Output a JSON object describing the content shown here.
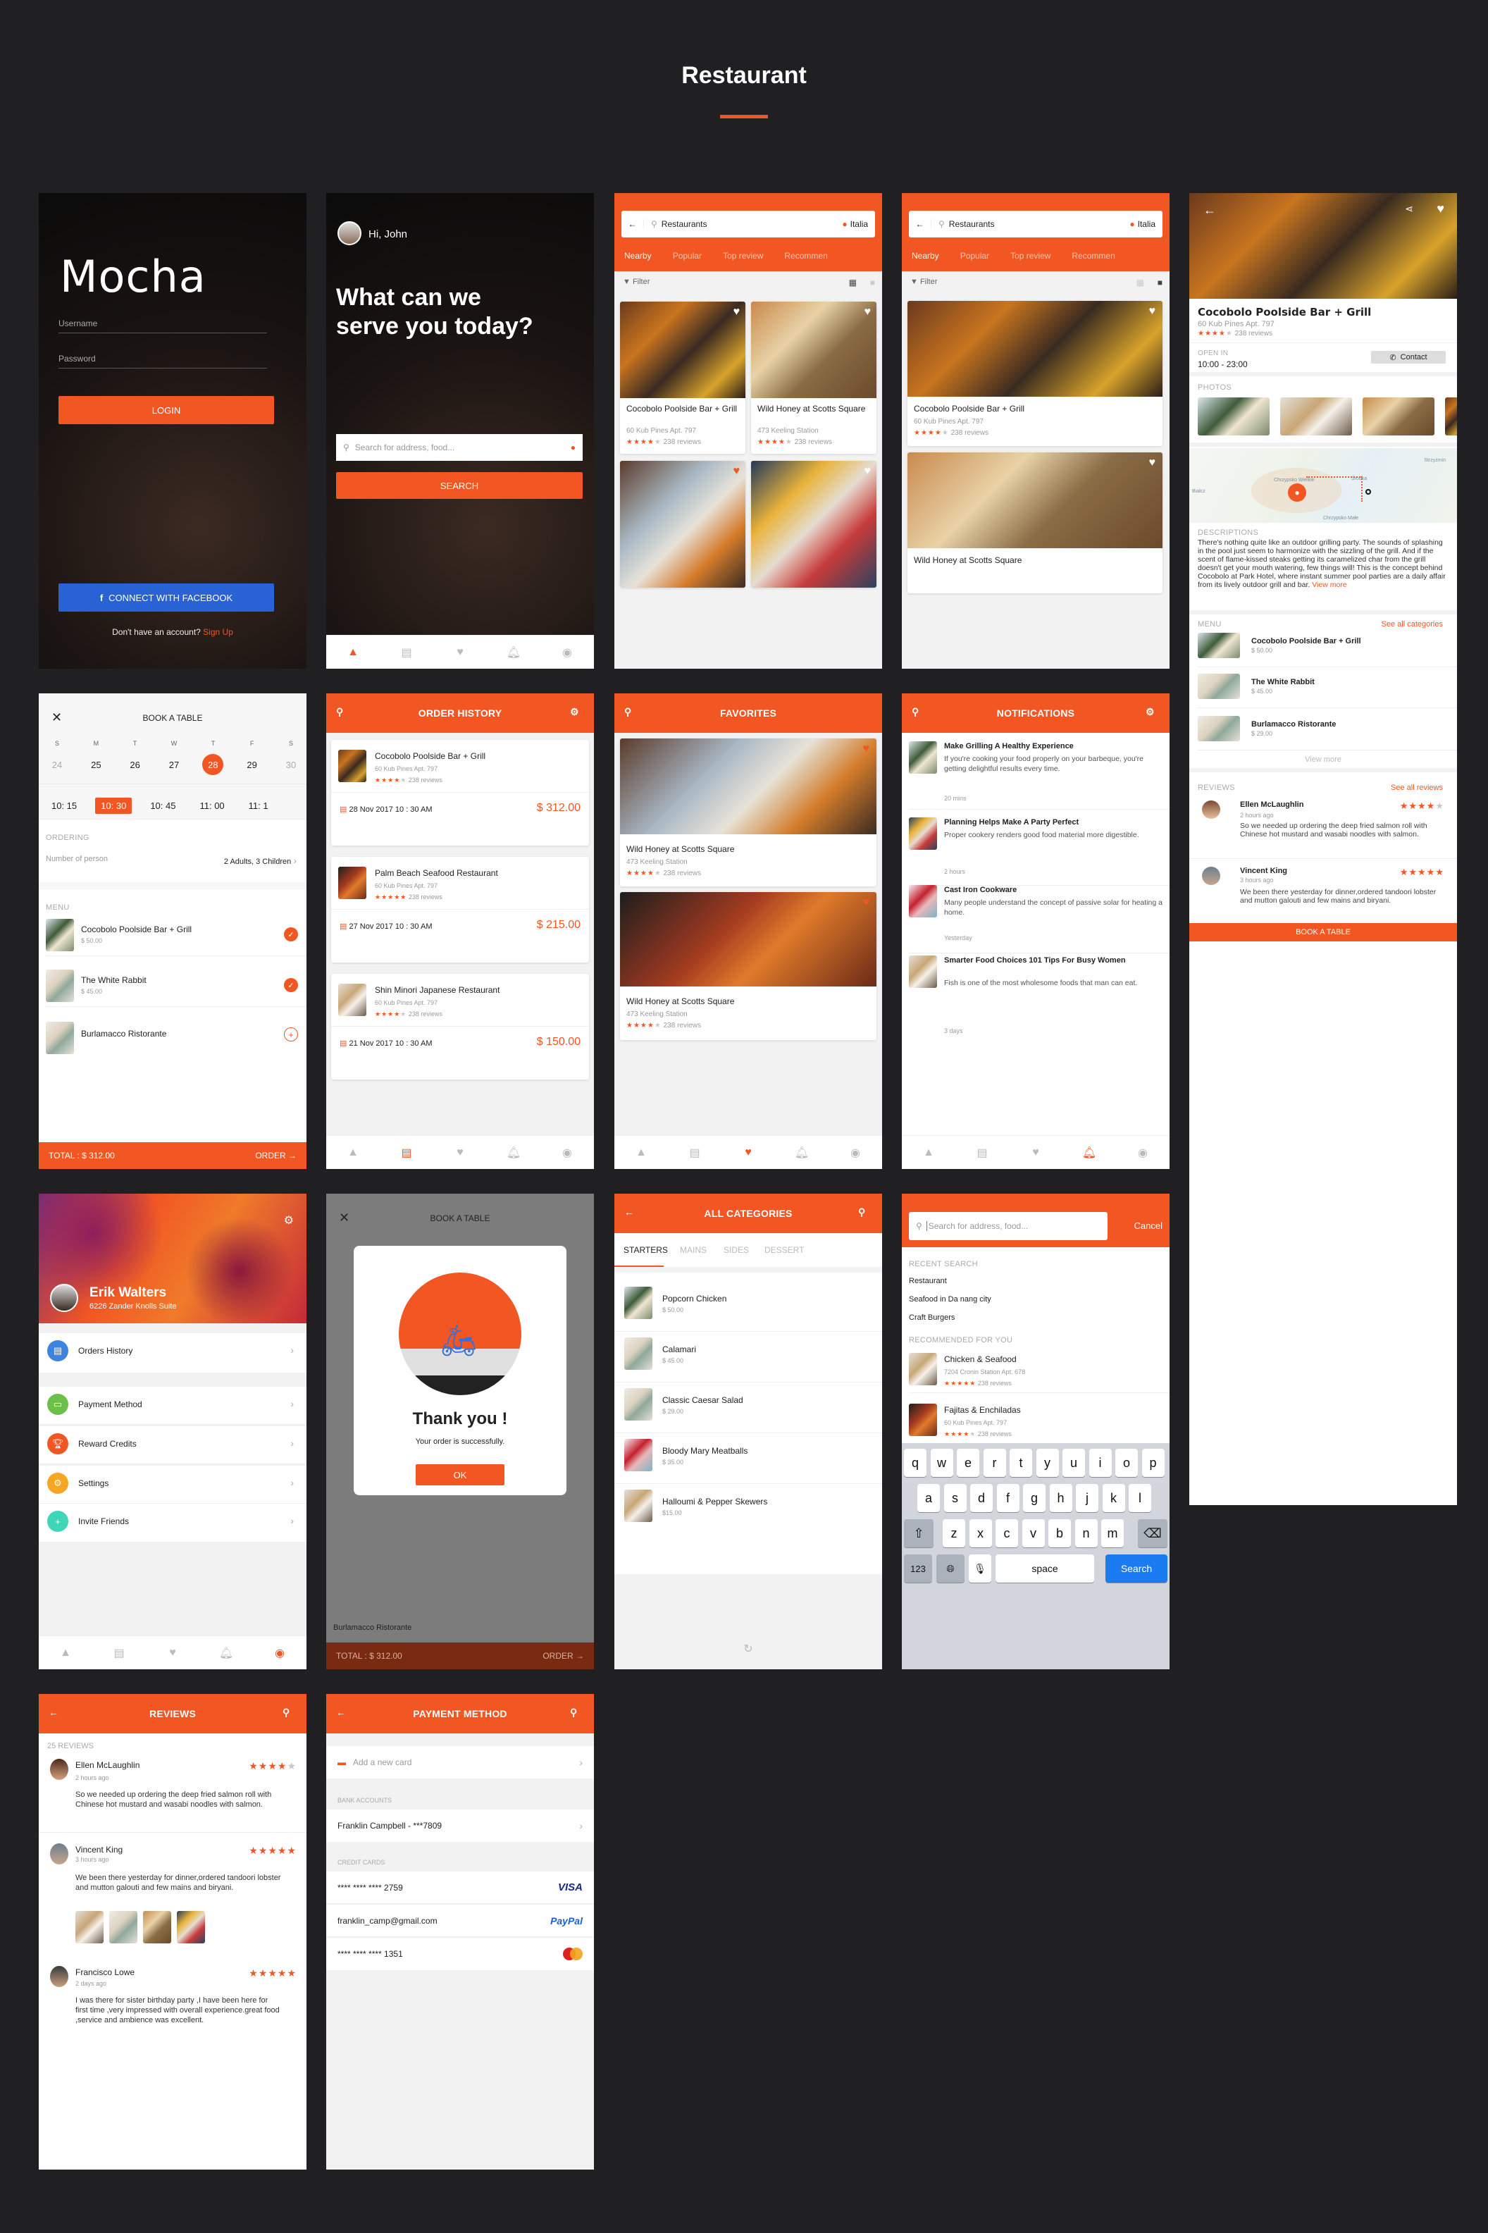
{
  "page": {
    "title": "Restaurant",
    "accent": "#f15623",
    "background": "#202022"
  },
  "login": {
    "logo": "Mocha",
    "username_placeholder": "Username",
    "password_placeholder": "Password",
    "login_button": "LOGIN",
    "facebook_button": "CONNECT WITH FACEBOOK",
    "signup_prompt": "Don't have an account?",
    "signup_link": "Sign Up"
  },
  "home": {
    "greeting": "Hi, John",
    "headline": "What can we serve you today?",
    "search_placeholder": "Search for address, food...",
    "search_button": "SEARCH"
  },
  "tabbar": {
    "icons": [
      "bell-dish-icon",
      "receipt-icon",
      "heart-icon",
      "bell-icon",
      "user-icon"
    ]
  },
  "listing": {
    "search_value": "Restaurants",
    "location": "Italia",
    "tabs": [
      "Nearby",
      "Popular",
      "Top review",
      "Recommen"
    ],
    "filter_label": "Filter",
    "items": [
      {
        "name": "Cocobolo Poolside Bar + Grill",
        "address": "60 Kub Pines Apt. 797",
        "rating": 4,
        "reviews": "238 reviews",
        "favorite": false
      },
      {
        "name": "Wild Honey at Scotts Square",
        "address": "473 Keeling Station",
        "rating": 4,
        "reviews": "238 reviews",
        "favorite": false
      },
      {
        "name": "",
        "address": "",
        "rating": 0,
        "reviews": "",
        "favorite": true
      },
      {
        "name": "",
        "address": "",
        "rating": 0,
        "reviews": "",
        "favorite": false
      }
    ],
    "list_second_title": "Wild Honey at Scotts Square"
  },
  "detail": {
    "name": "Cocobolo Poolside Bar + Grill",
    "address": "60 Kub Pines Apt. 797",
    "rating": 4,
    "reviews": "238 reviews",
    "open_label": "OPEN IN",
    "hours": "10:00 - 23:00",
    "contact_button": "Contact",
    "photos_label": "PHOTOS",
    "map_labels": [
      "Strzyżmin",
      "Chrzypsko Wielkie",
      "Środka",
      "Bialcz",
      "Chrzypsko Małe"
    ],
    "descriptions_label": "DESCRIPTIONS",
    "description": "There's nothing quite like an outdoor grilling party. The sounds of splashing in the pool just seem to harmonize with the sizzling of the grill. And if the scent of flame-kissed steaks getting its caramelized char from the grill doesn't get your mouth watering, few things will! This is the concept behind Cocobolo at Park Hotel, where instant summer pool parties are a daily affair from its lively outdoor grill and bar.",
    "view_more": "View more",
    "menu_label": "MENU",
    "see_all_categories": "See all categories",
    "menu": [
      {
        "name": "Cocobolo Poolside Bar + Grill",
        "price": "$ 50.00"
      },
      {
        "name": "The White Rabbit",
        "price": "$ 45.00"
      },
      {
        "name": "Burlamacco Ristorante",
        "price": "$ 29.00"
      }
    ],
    "menu_view_more": "View more",
    "reviews_label": "REVIEWS",
    "see_all_reviews": "See all reviews",
    "review_list": [
      {
        "name": "Ellen McLaughlin",
        "time": "2 hours ago",
        "rating": 4,
        "text": "So we needed up ordering the deep fried salmon roll with Chinese hot mustard and wasabi noodles with salmon."
      },
      {
        "name": "Vincent King",
        "time": "3 hours ago",
        "rating": 5,
        "text": "We been there yesterday for dinner,ordered tandoori lobster and mutton galouti and few mains and biryani."
      }
    ],
    "book_button": "BOOK A TABLE"
  },
  "booking": {
    "title": "BOOK A TABLE",
    "weekdays": [
      "S",
      "M",
      "T",
      "W",
      "T",
      "F",
      "S"
    ],
    "dates": [
      "24",
      "25",
      "26",
      "27",
      "28",
      "29",
      "30"
    ],
    "selected_date": "28",
    "times": [
      "10: 15",
      "10: 30",
      "10: 45",
      "11: 00",
      "11: 1"
    ],
    "selected_time": "10: 30",
    "ordering_label": "ORDERING",
    "persons_label": "Number of person",
    "persons_value": "2 Adults,  3 Children",
    "menu_label": "MENU",
    "menu": [
      {
        "name": "Cocobolo Poolside Bar + Grill",
        "price": "$ 50.00",
        "checked": true
      },
      {
        "name": "The White Rabbit",
        "price": "$ 45.00",
        "checked": true
      },
      {
        "name": "Burlamacco Ristorante",
        "price": "",
        "checked": false
      }
    ],
    "total": "TOTAL : $ 312.00",
    "order_button": "ORDER"
  },
  "orders": {
    "title": "ORDER HISTORY",
    "items": [
      {
        "name": "Cocobolo Poolside Bar + Grill",
        "address": "60 Kub Pines Apt. 797",
        "rating": 4,
        "reviews": "238 reviews",
        "date": "28 Nov 2017 10 : 30 AM",
        "price": "$ 312.00"
      },
      {
        "name": "Palm Beach Seafood Restaurant",
        "address": "60 Kub Pines Apt. 797",
        "rating": 5,
        "reviews": "238 reviews",
        "date": "27 Nov 2017 10 : 30 AM",
        "price": "$ 215.00"
      },
      {
        "name": "Shin Minori Japanese Restaurant",
        "address": "60 Kub Pines Apt. 797",
        "rating": 4,
        "reviews": "238 reviews",
        "date": "21 Nov 2017 10 : 30 AM",
        "price": "$ 150.00"
      }
    ]
  },
  "favorites": {
    "title": "FAVORITES",
    "items": [
      {
        "name": "Wild Honey at Scotts Square",
        "address": "473 Keeling Station",
        "rating": 4,
        "reviews": "238 reviews"
      },
      {
        "name": "Wild Honey at Scotts Square",
        "address": "473 Keeling Station",
        "rating": 4,
        "reviews": "238 reviews"
      }
    ]
  },
  "notifications": {
    "title": "NOTIFICATIONS",
    "items": [
      {
        "title": "Make Grilling A Healthy Experience",
        "body": "If you're cooking your food properly on your barbeque, you're getting delightful results every time.",
        "time": "20 mins"
      },
      {
        "title": "Planning Helps Make A Party Perfect",
        "body": "Proper cookery renders good food material more digestible.",
        "time": "2 hours"
      },
      {
        "title": "Cast Iron Cookware",
        "body": "Many people understand the concept of passive solar for heating a home.",
        "time": "Yesterday"
      },
      {
        "title": "Smarter Food Choices 101 Tips For Busy Women",
        "body": "Fish is one of the most wholesome foods that man can eat.",
        "time": "3 days"
      }
    ]
  },
  "profile": {
    "name": "Erik Walters",
    "address": "6226 Zander Knolls Suite",
    "items": [
      {
        "label": "Orders History",
        "color": "#3f83e0"
      },
      {
        "label": "Payment Method",
        "color": "#6cc04a"
      },
      {
        "label": "Reward Credits",
        "color": "#f15623"
      },
      {
        "label": "Settings",
        "color": "#f5a623"
      },
      {
        "label": "Invite Friends",
        "color": "#3fd6b8"
      }
    ]
  },
  "thankyou": {
    "title": "Thank you !",
    "message": "Your order is successfully.",
    "ok_button": "OK",
    "bg_title": "BOOK A TABLE",
    "bg_total": "TOTAL : $ 312.00",
    "bg_order": "ORDER",
    "bg_item": "Burlamacco Ristorante"
  },
  "categories": {
    "title": "ALL CATEGORIES",
    "tabs": [
      "STARTERS",
      "MAINS",
      "SIDES",
      "DESSERT"
    ],
    "active_tab": "STARTERS",
    "items": [
      {
        "name": "Popcorn Chicken",
        "price": "$ 50.00"
      },
      {
        "name": "Calamari",
        "price": "$ 45.00"
      },
      {
        "name": "Classic Caesar Salad",
        "price": "$ 29.00"
      },
      {
        "name": "Bloody Mary Meatballs",
        "price": "$ 35.00"
      },
      {
        "name": "Halloumi & Pepper Skewers",
        "price": "$15.00"
      }
    ]
  },
  "search": {
    "placeholder": "Search for address, food...",
    "cancel": "Cancel",
    "recent_label": "RECENT SEARCH",
    "recent": [
      "Restaurant",
      "Seafood in Da nang city",
      "Craft Burgers"
    ],
    "recommended_label": "RECOMMENDED FOR YOU",
    "recommended": [
      {
        "name": "Chicken & Seafood",
        "address": "7204 Cronin Station Apt. 678",
        "rating": 5,
        "reviews": "238 reviews"
      },
      {
        "name": "Fajitas & Enchiladas",
        "address": "60 Kub Pines Apt. 797",
        "rating": 4,
        "reviews": "238 reviews"
      }
    ],
    "keyboard": {
      "row1": [
        "q",
        "w",
        "e",
        "r",
        "t",
        "y",
        "u",
        "i",
        "o",
        "p"
      ],
      "row2": [
        "a",
        "s",
        "d",
        "f",
        "g",
        "h",
        "j",
        "k",
        "l"
      ],
      "row3": [
        "z",
        "x",
        "c",
        "v",
        "b",
        "n",
        "m"
      ],
      "num": "123",
      "space": "space",
      "search": "Search"
    }
  },
  "reviews": {
    "title": "REVIEWS",
    "count": "25 REVIEWS",
    "items": [
      {
        "name": "Ellen McLaughlin",
        "time": "2 hours ago",
        "rating": 4,
        "text": "So we needed up ordering the deep fried salmon roll with Chinese hot mustard and wasabi noodles with salmon."
      },
      {
        "name": "Vincent King",
        "time": "3 hours ago",
        "rating": 5,
        "text": "We been there yesterday for dinner,ordered tandoori lobster and mutton galouti and few mains and biryani."
      },
      {
        "name": "Francisco Lowe",
        "time": "2 days ago",
        "rating": 5,
        "text": "I was there for sister birthday party ,I have been here for first time ,very impressed with overall experience.great food ,service and ambience was excellent."
      }
    ]
  },
  "payment": {
    "title": "PAYMENT METHOD",
    "add_card": "Add a new card",
    "bank_label": "BANK ACCOUNTS",
    "bank_account": "Franklin Campbell - ***7809",
    "cards_label": "CREDIT CARDS",
    "cards": [
      {
        "number": "**** **** **** 2759",
        "brand": "VISA"
      },
      {
        "number": "franklin_camp@gmail.com",
        "brand": "PayPal"
      },
      {
        "number": "**** **** **** 1351",
        "brand": "MasterCard"
      }
    ]
  }
}
